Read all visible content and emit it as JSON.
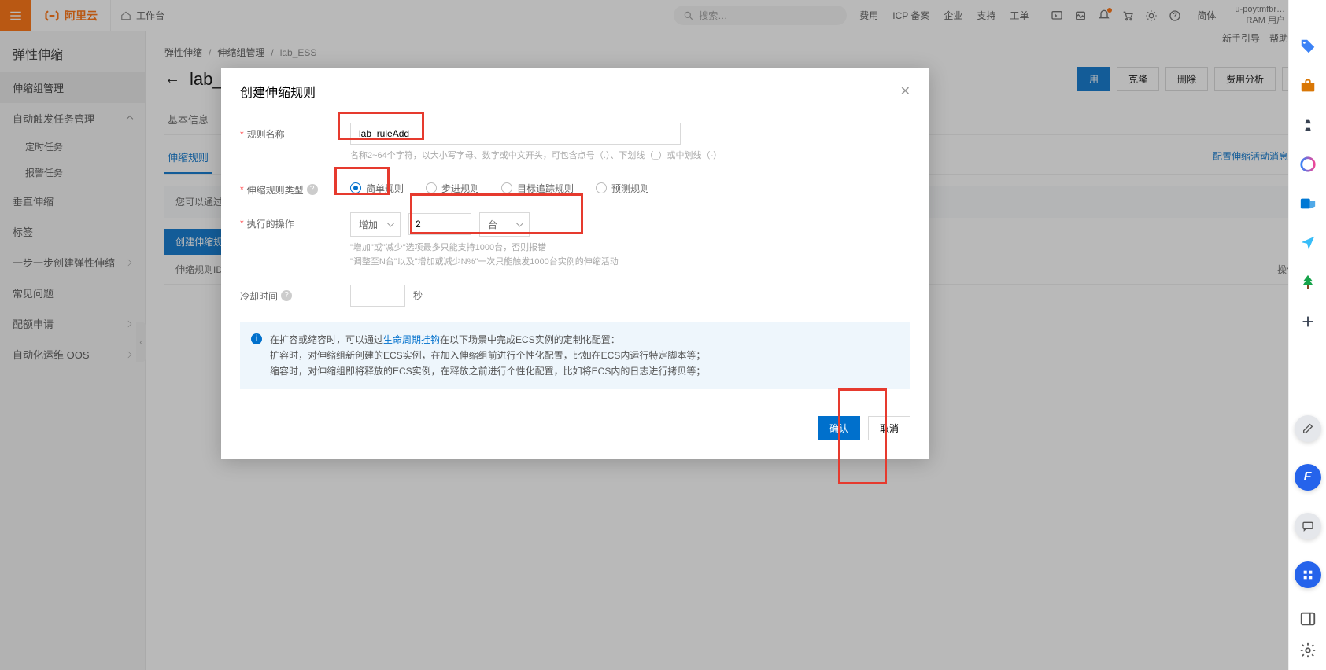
{
  "header": {
    "brand": "阿里云",
    "workspace_label": "工作台",
    "search_placeholder": "搜索…",
    "links": [
      "费用",
      "ICP 备案",
      "企业",
      "支持",
      "工单"
    ],
    "lang": "简体",
    "username": "u-poytmfbr…",
    "user_role": "RAM 用户"
  },
  "sidebar": {
    "title": "弹性伸缩",
    "items": [
      {
        "label": "伸缩组管理",
        "active": true
      },
      {
        "label": "自动触发任务管理",
        "expandable": true
      },
      {
        "label": "定时任务",
        "sub": true
      },
      {
        "label": "报警任务",
        "sub": true
      },
      {
        "label": "垂直伸缩"
      },
      {
        "label": "标签"
      },
      {
        "label": "一步一步创建弹性伸缩",
        "ext": true
      },
      {
        "label": "常见问题"
      },
      {
        "label": "配额申请",
        "ext": true
      },
      {
        "label": "自动化运维 OOS",
        "ext": true
      }
    ]
  },
  "crumbs": [
    "弹性伸缩",
    "伸缩组管理",
    "lab_ESS"
  ],
  "top_actions": {
    "guide": "新手引导",
    "docs": "帮助文档"
  },
  "head_btns": {
    "enable": "用",
    "clone": "克隆",
    "delete": "删除",
    "cost": "费用分析"
  },
  "page": {
    "title": "lab_"
  },
  "tabs": {
    "basic": "基本信息"
  },
  "sub_tabs": {
    "rules": "伸缩规则",
    "cfg_link": "配置伸缩活动消息通知"
  },
  "helper_bar": "您可以通过引",
  "create_rule_btn": "创建伸缩规则",
  "table": {
    "col1": "伸缩规则ID/名",
    "op": "操作"
  },
  "modal": {
    "title": "创建伸缩规则",
    "labels": {
      "rule_name": "规则名称",
      "rule_type": "伸缩规则类型",
      "action": "执行的操作",
      "cooldown": "冷却时间",
      "seconds": "秒"
    },
    "rule_name_value": "lab_ruleAdd",
    "rule_name_hint": "名称2~64个字符，以大小写字母、数字或中文开头，可包含点号（.）、下划线（_）或中划线（-）",
    "rule_types": [
      "简单规则",
      "步进规则",
      "目标追踪规则",
      "预测规则"
    ],
    "action_mode": "增加",
    "action_value": "2",
    "action_unit": "台",
    "action_hint1": "\"增加\"或\"减少\"选项最多只能支持1000台，否则报错",
    "action_hint2": "\"调整至N台\"以及\"增加或减少N%\"一次只能触发1000台实例的伸缩活动",
    "info_line1_a": "在扩容或缩容时，可以通过",
    "info_link": "生命周期挂钩",
    "info_line1_b": "在以下场景中完成ECS实例的定制化配置：",
    "info_line2": "扩容时，对伸缩组新创建的ECS实例，在加入伸缩组前进行个性化配置，比如在ECS内运行特定脚本等；",
    "info_line3": "缩容时，对伸缩组即将释放的ECS实例，在释放之前进行个性化配置，比如将ECS内的日志进行拷贝等；",
    "ok": "确认",
    "cancel": "取消"
  }
}
